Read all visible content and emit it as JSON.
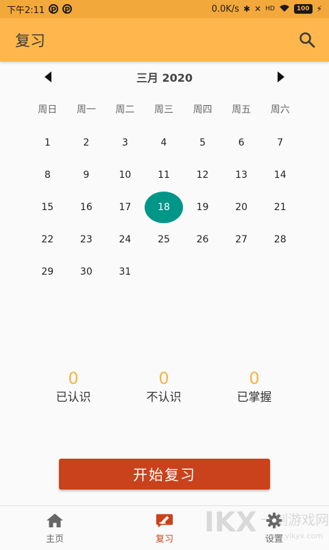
{
  "status_bar": {
    "time": "下午2:11",
    "badge1": "P",
    "badge2": "P",
    "speed": "0.0K/s",
    "hd": "HD",
    "battery": "100"
  },
  "app_bar": {
    "title": "复习",
    "search_icon": "search-icon"
  },
  "calendar": {
    "month_label": "三月 2020",
    "weekdays": [
      "周日",
      "周一",
      "周二",
      "周三",
      "周四",
      "周五",
      "周六"
    ],
    "days": [
      "1",
      "2",
      "3",
      "4",
      "5",
      "6",
      "7",
      "8",
      "9",
      "10",
      "11",
      "12",
      "13",
      "14",
      "15",
      "16",
      "17",
      "18",
      "19",
      "20",
      "21",
      "22",
      "23",
      "24",
      "25",
      "26",
      "27",
      "28",
      "29",
      "30",
      "31"
    ],
    "selected_day": "18",
    "selected_color": "#009688"
  },
  "stats": [
    {
      "value": "0",
      "label": "已认识"
    },
    {
      "value": "0",
      "label": "不认识"
    },
    {
      "value": "0",
      "label": "已掌握"
    }
  ],
  "start_button": {
    "label": "开始复习",
    "color": "#c9421b"
  },
  "bottom_nav": [
    {
      "label": "主页",
      "icon": "home-icon",
      "active": false
    },
    {
      "label": "复习",
      "icon": "review-icon",
      "active": true
    },
    {
      "label": "设置",
      "icon": "gear-icon",
      "active": false
    }
  ],
  "watermark": {
    "text": "一刻游戏网",
    "url": "www.yikyx.com"
  }
}
